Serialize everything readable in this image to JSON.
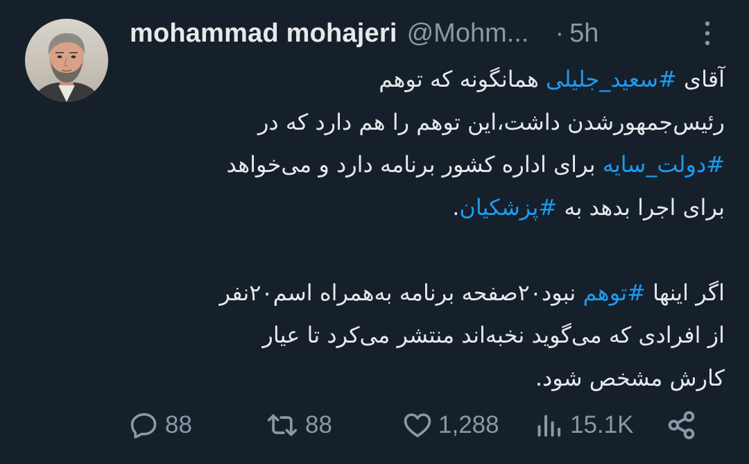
{
  "author": {
    "name": "mohammad mohajeri",
    "handle": "@Mohm...",
    "separator": "·",
    "time": "5h"
  },
  "tweet": {
    "lines": [
      [
        {
          "t": "آقای "
        },
        {
          "t": "#سعید_جلیلی",
          "tag": true
        },
        {
          "t": " همانگونه که توهم"
        }
      ],
      [
        {
          "t": "رئیس‌جمهورشدن داشت،این توهم را هم دارد که در"
        }
      ],
      [
        {
          "t": "#دولت_سایه",
          "tag": true
        },
        {
          "t": " برای اداره کشور برنامه دارد و می‌خواهد"
        }
      ],
      [
        {
          "t": "برای اجرا بدهد به "
        },
        {
          "t": "#پزشکیان",
          "tag": true
        },
        {
          "t": "."
        }
      ],
      [],
      [
        {
          "t": "اگر اینها "
        },
        {
          "t": "#توهم",
          "tag": true
        },
        {
          "t": " نبود۲۰صفحه برنامه به‌همراه اسم۲۰نفر"
        }
      ],
      [
        {
          "t": "از افرادی که می‌گوید نخبه‌اند منتشر می‌کرد تا عیار"
        }
      ],
      [
        {
          "t": "کارش مشخص شود."
        }
      ]
    ]
  },
  "actions": {
    "replies": "88",
    "retweets": "88",
    "likes": "1,288",
    "views": "15.1K"
  },
  "icons": {
    "more": "more-vertical-icon",
    "reply": "reply-icon",
    "retweet": "retweet-icon",
    "like": "heart-icon",
    "views": "views-icon",
    "share": "share-icon"
  },
  "colors": {
    "background": "#15202b",
    "text": "#e7e9ea",
    "secondary": "#8b98a5",
    "link": "#1d9bf0"
  }
}
